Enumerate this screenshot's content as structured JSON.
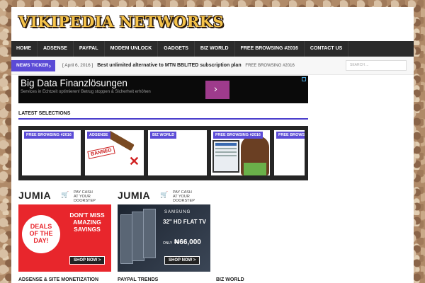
{
  "site": {
    "title": "VIKIPEDIA NETWORKS"
  },
  "nav": {
    "items": [
      "HOME",
      "ADSENSE",
      "PAYPAL",
      "MODEM UNLOCK",
      "GADGETS",
      "BIZ WORLD",
      "FREE BROWSING #2016",
      "CONTACT US"
    ]
  },
  "ticker": {
    "label": "NEWS TICKER",
    "date": "[ April 6, 2016 ]",
    "headline": "Best unlimited alternative to MTN BBLITED subscription plan",
    "category": "FREE BROWSING #2016",
    "search_placeholder": "SEARCH ..."
  },
  "ad": {
    "title": "Big Data Finanzlösungen",
    "subtitle": "Services in Echtzeit optimieren! Betrug stoppen & Sicherheit erhöhen"
  },
  "latest": {
    "heading": "LATEST SELECTIONS",
    "slides": [
      {
        "tag": "FREE BROWSING #2016"
      },
      {
        "tag": "ADSENSE",
        "stamp": "BANNED"
      },
      {
        "tag": "BIZ WORLD"
      },
      {
        "tag": "FREE BROWSING #2016"
      },
      {
        "tag": "FREE BROWSING"
      }
    ]
  },
  "promos": [
    {
      "brand": "JUMIA",
      "tagline_1": "PAY CASH",
      "tagline_2": "AT YOUR DOORSTEP",
      "deal_1": "DEALS",
      "deal_2": "OF THE",
      "deal_3": "DAY!",
      "text": "DON'T MISS AMAZING SAVINGS",
      "button": "SHOP NOW >"
    },
    {
      "brand": "JUMIA",
      "tagline_1": "PAY CASH",
      "tagline_2": "AT YOUR DOORSTEP",
      "product_brand": "SAMSUNG",
      "product": "32\" HD FLAT TV",
      "only": "ONLY",
      "price": "₦66,000",
      "button": "SHOP NOW >"
    }
  ],
  "bottom_sections": [
    "ADSENSE & SITE MONETIZATION",
    "PAYPAL TRENDS",
    "BIZ WORLD"
  ],
  "colors": {
    "accent": "#5b4bd6",
    "nav": "#2b2b2b",
    "brand_gold": "#f5c34a"
  }
}
